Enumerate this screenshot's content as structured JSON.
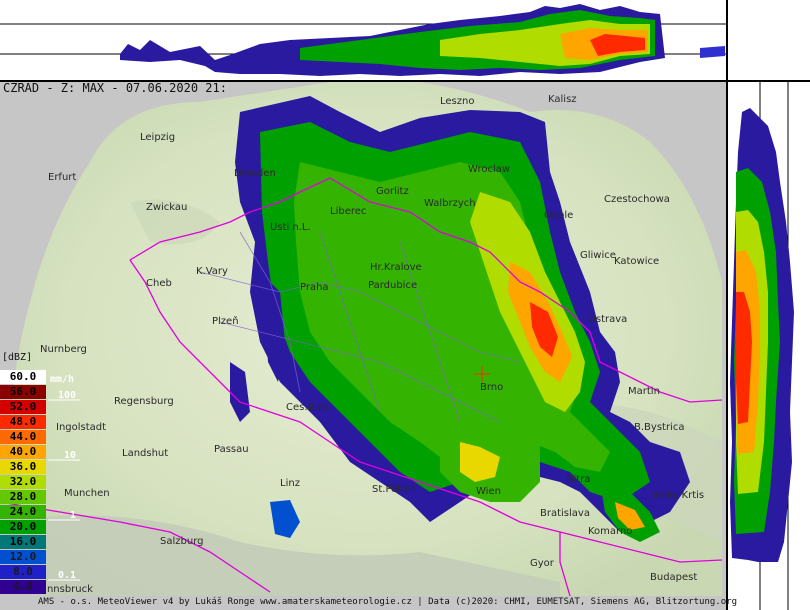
{
  "title": "CZRAD - Z: MAX - 07.06.2020 21:",
  "footer": "AMS - o.s. MeteoViewer v4 by Lukáš Ronge www.amaterskameteorologie.cz | Data (c)2020: CHMI, EUMETSAT, Siemens AG, Blitzortung.org",
  "legend": {
    "unit_dbz": "[dBZ]",
    "unit_mmh": "mm/h",
    "rows": [
      {
        "value": "60.0",
        "bg": "#ffffff",
        "fg": "#000000"
      },
      {
        "value": "56.0",
        "bg": "#8b0000",
        "fg": "#000000"
      },
      {
        "value": "52.0",
        "bg": "#d40000",
        "fg": "#000000"
      },
      {
        "value": "48.0",
        "bg": "#ff2a00",
        "fg": "#000000"
      },
      {
        "value": "44.0",
        "bg": "#ff6a00",
        "fg": "#000000"
      },
      {
        "value": "40.0",
        "bg": "#ffa500",
        "fg": "#000000"
      },
      {
        "value": "36.0",
        "bg": "#e8d800",
        "fg": "#000000"
      },
      {
        "value": "32.0",
        "bg": "#b0dc00",
        "fg": "#000000"
      },
      {
        "value": "28.0",
        "bg": "#64c800",
        "fg": "#000000"
      },
      {
        "value": "24.0",
        "bg": "#34b400",
        "fg": "#000000"
      },
      {
        "value": "20.0",
        "bg": "#00a000",
        "fg": "#000000"
      },
      {
        "value": "16.0",
        "bg": "#007878",
        "fg": "#000000"
      },
      {
        "value": "12.0",
        "bg": "#0050d0",
        "fg": "#1a1a1a"
      },
      {
        "value": "8.0",
        "bg": "#2020c8",
        "fg": "#1a1a1a"
      },
      {
        "value": "4.0",
        "bg": "#300090",
        "fg": "#1a1a1a"
      }
    ],
    "mmh_marks": [
      "100",
      "10",
      "1",
      "0.1"
    ]
  },
  "cities": [
    {
      "name": "Leipzig"
    },
    {
      "name": "Erfurt"
    },
    {
      "name": "Zwickau"
    },
    {
      "name": "Cheb"
    },
    {
      "name": "K.Vary"
    },
    {
      "name": "Plzeň"
    },
    {
      "name": "Nurnberg"
    },
    {
      "name": "Regensburg"
    },
    {
      "name": "Ingolstadt"
    },
    {
      "name": "Landshut"
    },
    {
      "name": "Passau"
    },
    {
      "name": "Munchen"
    },
    {
      "name": "Salzburg"
    },
    {
      "name": "Innsbruck"
    },
    {
      "name": "Linz"
    },
    {
      "name": "St.Polten"
    },
    {
      "name": "Wien"
    },
    {
      "name": "Bratislava"
    },
    {
      "name": "Gyor"
    },
    {
      "name": "Komarno"
    },
    {
      "name": "Budapest"
    },
    {
      "name": "Nitra"
    },
    {
      "name": "B.Bystrica"
    },
    {
      "name": "Velky Krtis"
    },
    {
      "name": "Martin"
    },
    {
      "name": "Ostrava"
    },
    {
      "name": "Gliwice"
    },
    {
      "name": "Katowice"
    },
    {
      "name": "Czestochowa"
    },
    {
      "name": "Opole"
    },
    {
      "name": "Wroclaw"
    },
    {
      "name": "Walbrzych"
    },
    {
      "name": "Gorlitz"
    },
    {
      "name": "Dresden"
    },
    {
      "name": "Usti n.L."
    },
    {
      "name": "Liberec"
    },
    {
      "name": "Hr.Kralove"
    },
    {
      "name": "Pardubice"
    },
    {
      "name": "Kalisz"
    },
    {
      "name": "Leszno"
    },
    {
      "name": "Ces.Bud."
    },
    {
      "name": "Praha"
    },
    {
      "name": "Brno"
    }
  ],
  "colors": {
    "map_land": "#d9e6c8",
    "map_edge": "#c6c6c6",
    "border": "#e000e0",
    "region": "#8060d0"
  }
}
